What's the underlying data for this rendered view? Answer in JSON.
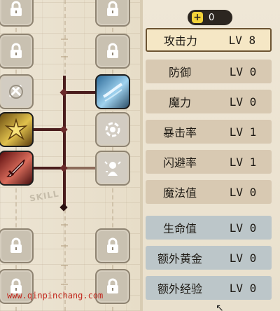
{
  "currency": {
    "value": "0",
    "icon": "plus-icon"
  },
  "stats": [
    {
      "name": "攻击力",
      "level": "LV 8",
      "state": "selected"
    },
    {
      "name": "防御",
      "level": "LV 0",
      "state": "tan"
    },
    {
      "name": "魔力",
      "level": "LV 0",
      "state": "tan"
    },
    {
      "name": "暴击率",
      "level": "LV 1",
      "state": "tan"
    },
    {
      "name": "闪避率",
      "level": "LV 1",
      "state": "tan"
    },
    {
      "name": "魔法值",
      "level": "LV 0",
      "state": "tan"
    },
    {
      "name": "生命值",
      "level": "LV 0",
      "state": "blue"
    },
    {
      "name": "额外黄金",
      "level": "LV 0",
      "state": "blue"
    },
    {
      "name": "额外经验",
      "level": "LV 0",
      "state": "blue"
    }
  ],
  "tree": {
    "label": "SKILL"
  },
  "watermark": "www.qinpinchang.com",
  "colors": {
    "branch": "#4a1d1d",
    "selected_border": "#6c5432",
    "currency_bg": "#2c2620",
    "watermark": "#c2271e"
  }
}
